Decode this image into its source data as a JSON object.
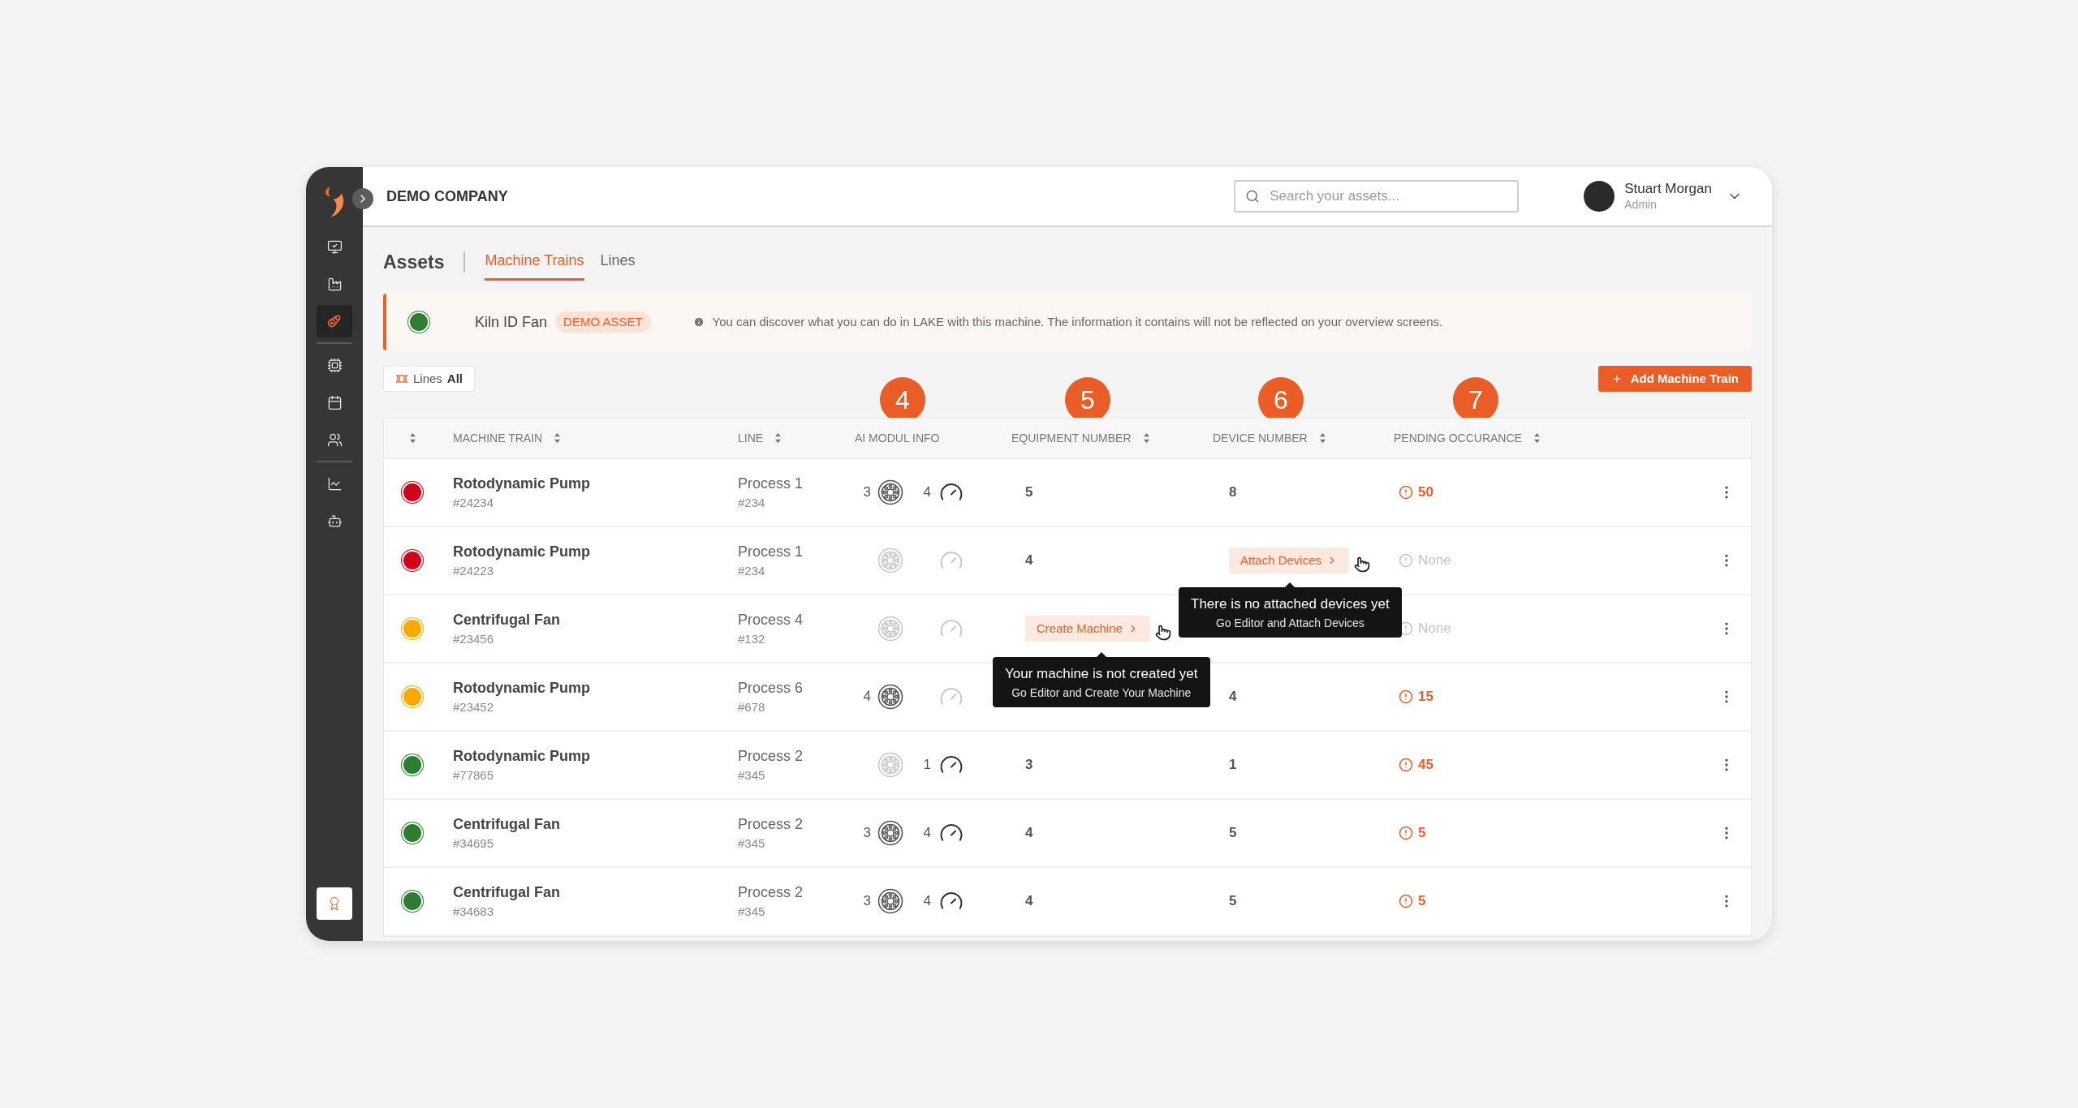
{
  "company": "DEMO COMPANY",
  "search": {
    "placeholder": "Search your assets..."
  },
  "user": {
    "name": "Stuart Morgan",
    "role": "Admin"
  },
  "sidebar": {
    "groups": [
      [
        {
          "selected": false
        },
        {
          "selected": false
        },
        {
          "selected": true
        }
      ],
      [
        {
          "selected": false
        },
        {
          "selected": false
        },
        {
          "selected": false
        }
      ],
      [
        {
          "selected": false
        },
        {
          "selected": false
        }
      ]
    ]
  },
  "page_title": "Assets",
  "tabs": [
    {
      "label": "Machine Trains",
      "selected": true
    },
    {
      "label": "Lines",
      "selected": false
    }
  ],
  "banner": {
    "name": "Kiln ID Fan",
    "color": "#2e7d32",
    "badge": "DEMO ASSET",
    "message": "You can discover what you can do in LAKE with this machine. The information it contains will not be reflected on your overview screens."
  },
  "filter": {
    "label": "Lines",
    "value": "All"
  },
  "add_button": "Add Machine Train",
  "columns": [
    {
      "label": "MACHINE TRAIN"
    },
    {
      "label": "LINE"
    },
    {
      "label": "AI MODUL INFO",
      "badge": "4"
    },
    {
      "label": "EQUIPMENT NUMBER",
      "badge": "5"
    },
    {
      "label": "DEVICE NUMBER",
      "badge": "6"
    },
    {
      "label": "PENDING OCCURANCE",
      "badge": "7"
    }
  ],
  "rows": [
    {
      "color": "#d0021b",
      "name": "Rotodynamic Pump",
      "id": "#24234",
      "line": "Process 1",
      "line_id": "#234",
      "vibration": {
        "count": "3",
        "active": true
      },
      "gauge": {
        "count": "4",
        "active": true
      },
      "equipment": {
        "kind": "value",
        "text": "5"
      },
      "device": {
        "kind": "value",
        "text": "8"
      },
      "pending": {
        "kind": "count",
        "text": "50"
      }
    },
    {
      "color": "#d0021b",
      "name": "Rotodynamic Pump",
      "id": "#24223",
      "line": "Process 1",
      "line_id": "#234",
      "vibration": {
        "active": false
      },
      "gauge": {
        "active": false
      },
      "equipment": {
        "kind": "value",
        "text": "4"
      },
      "device": {
        "kind": "button",
        "text": "Attach Devices",
        "tooltip": {
          "title": "There is no attached devices yet",
          "subtitle": "Go Editor and Attach Devices"
        }
      },
      "pending": {
        "kind": "none",
        "text": "None"
      }
    },
    {
      "color": "#ffa800",
      "name": "Centrifugal Fan",
      "id": "#23456",
      "line": "Process 4",
      "line_id": "#132",
      "vibration": {
        "active": false
      },
      "gauge": {
        "active": false
      },
      "equipment": {
        "kind": "button",
        "text": "Create Machine",
        "tooltip": {
          "title": "Your machine is not created yet",
          "subtitle": "Go Editor and Create Your Machine"
        }
      },
      "device": {
        "kind": "empty"
      },
      "pending": {
        "kind": "none",
        "text": "None"
      }
    },
    {
      "color": "#ffa800",
      "name": "Rotodynamic Pump",
      "id": "#23452",
      "line": "Process 6",
      "line_id": "#678",
      "vibration": {
        "count": "4",
        "active": true
      },
      "gauge": {
        "active": false
      },
      "equipment": {
        "kind": "empty"
      },
      "device": {
        "kind": "value",
        "text": "4"
      },
      "pending": {
        "kind": "count",
        "text": "15"
      }
    },
    {
      "color": "#2e7d32",
      "name": "Rotodynamic Pump",
      "id": "#77865",
      "line": "Process 2",
      "line_id": "#345",
      "vibration": {
        "active": false
      },
      "gauge": {
        "count": "1",
        "active": true
      },
      "equipment": {
        "kind": "value",
        "text": "3"
      },
      "device": {
        "kind": "value",
        "text": "1"
      },
      "pending": {
        "kind": "count",
        "text": "45"
      }
    },
    {
      "color": "#2e7d32",
      "name": "Centrifugal Fan",
      "id": "#34695",
      "line": "Process 2",
      "line_id": "#345",
      "vibration": {
        "count": "3",
        "active": true
      },
      "gauge": {
        "count": "4",
        "active": true
      },
      "equipment": {
        "kind": "value",
        "text": "4"
      },
      "device": {
        "kind": "value",
        "text": "5"
      },
      "pending": {
        "kind": "count",
        "text": "5"
      }
    },
    {
      "color": "#2e7d32",
      "name": "Centrifugal Fan",
      "id": "#34683",
      "line": "Process 2",
      "line_id": "#345",
      "vibration": {
        "count": "3",
        "active": true
      },
      "gauge": {
        "count": "4",
        "active": true
      },
      "equipment": {
        "kind": "value",
        "text": "4"
      },
      "device": {
        "kind": "value",
        "text": "5"
      },
      "pending": {
        "kind": "count",
        "text": "5"
      }
    }
  ]
}
